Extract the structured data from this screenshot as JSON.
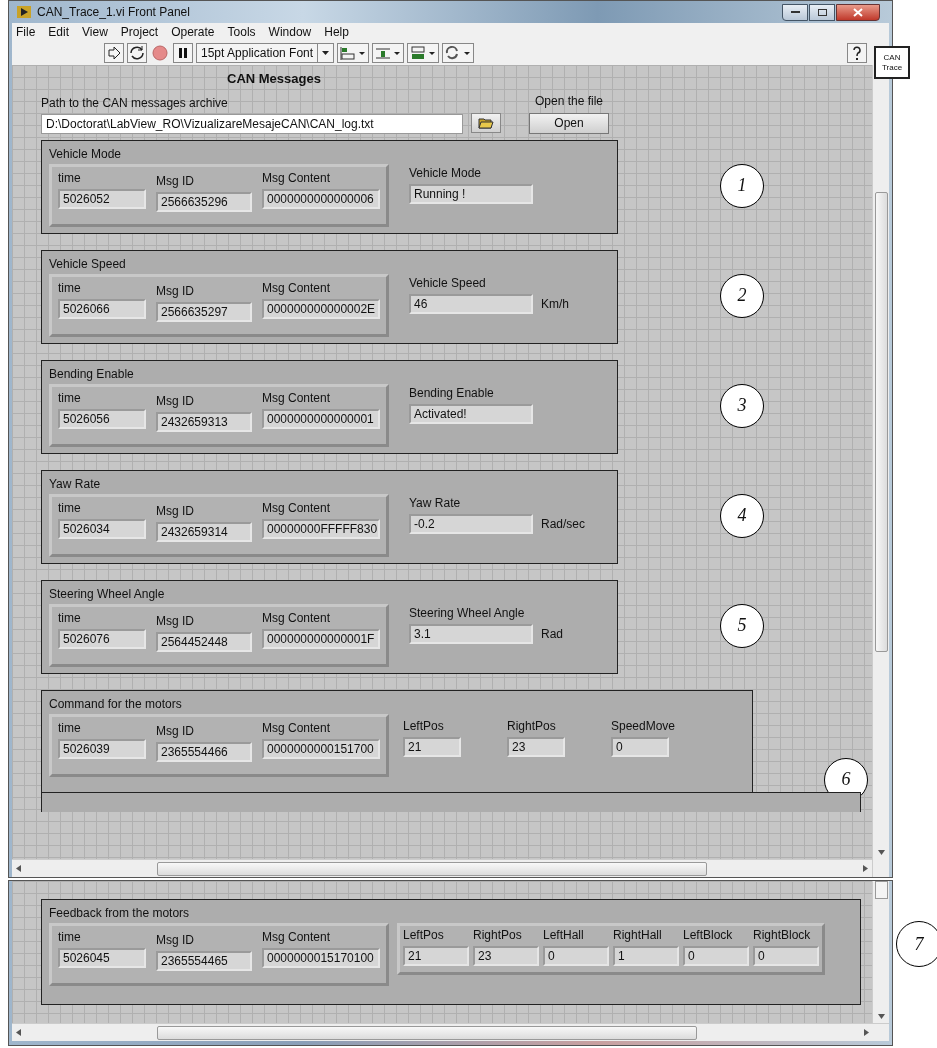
{
  "window": {
    "title": "CAN_Trace_1.vi Front Panel"
  },
  "menu": [
    "File",
    "Edit",
    "View",
    "Project",
    "Operate",
    "Tools",
    "Window",
    "Help"
  ],
  "toolbar": {
    "font": "15pt Application Font",
    "vi_icon": "CAN Trace"
  },
  "panel": {
    "heading": "CAN Messages",
    "path_label": "Path to the CAN messages archive",
    "path": "D:\\Doctorat\\LabView_RO\\VizualizareMesajeCAN\\CAN_log.txt",
    "open_label": "Open the file",
    "open_button": "Open"
  },
  "clusters": [
    {
      "kind": "wide",
      "title": "Vehicle Mode",
      "fields": [
        {
          "label": "time",
          "value": "5026052"
        },
        {
          "label": "Msg ID",
          "value": "2566635296"
        },
        {
          "label": "Msg Content",
          "value": "0000000000000006"
        }
      ],
      "outputs": [
        {
          "label": "Vehicle Mode",
          "value": "Running !"
        }
      ],
      "annotation": "1"
    },
    {
      "kind": "wide",
      "title": "Vehicle Speed",
      "fields": [
        {
          "label": "time",
          "value": "5026066"
        },
        {
          "label": "Msg ID",
          "value": "2566635297"
        },
        {
          "label": "Msg Content",
          "value": "000000000000002E"
        }
      ],
      "outputs": [
        {
          "label": "Vehicle Speed",
          "value": "46",
          "unit": "Km/h"
        }
      ],
      "annotation": "2"
    },
    {
      "kind": "wide",
      "title": "Bending Enable",
      "fields": [
        {
          "label": "time",
          "value": "5026056"
        },
        {
          "label": "Msg ID",
          "value": "2432659313"
        },
        {
          "label": "Msg Content",
          "value": "0000000000000001"
        }
      ],
      "outputs": [
        {
          "label": "Bending Enable",
          "value": "Activated!"
        }
      ],
      "annotation": "3"
    },
    {
      "kind": "wide",
      "title": "Yaw Rate",
      "fields": [
        {
          "label": "time",
          "value": "5026034"
        },
        {
          "label": "Msg ID",
          "value": "2432659314"
        },
        {
          "label": "Msg Content",
          "value": "00000000FFFFF830"
        }
      ],
      "outputs": [
        {
          "label": "Yaw Rate",
          "value": "-0.2",
          "unit": "Rad/sec"
        }
      ],
      "annotation": "4"
    },
    {
      "kind": "wide",
      "title": "Steering Wheel Angle",
      "fields": [
        {
          "label": "time",
          "value": "5026076"
        },
        {
          "label": "Msg ID",
          "value": "2564452448"
        },
        {
          "label": "Msg Content",
          "value": "000000000000001F"
        }
      ],
      "outputs": [
        {
          "label": "Steering Wheel Angle",
          "value": "3.1",
          "unit": "Rad"
        }
      ],
      "annotation": "5"
    },
    {
      "kind": "row",
      "title": "Command for the motors",
      "fields": [
        {
          "label": "time",
          "value": "5026039"
        },
        {
          "label": "Msg ID",
          "value": "2365554466"
        },
        {
          "label": "Msg Content",
          "value": "0000000000151700"
        }
      ],
      "outputs": [
        {
          "label": "LeftPos",
          "value": "21"
        },
        {
          "label": "RightPos",
          "value": "23"
        },
        {
          "label": "SpeedMove",
          "value": "0"
        }
      ],
      "annotation": "6"
    }
  ],
  "feedback": {
    "kind": "grouped",
    "title": "Feedback from the motors",
    "fields": [
      {
        "label": "time",
        "value": "5026045"
      },
      {
        "label": "Msg ID",
        "value": "2365554465"
      },
      {
        "label": "Msg Content",
        "value": "0000000015170100"
      }
    ],
    "outputs": [
      {
        "label": "LeftPos",
        "value": "21"
      },
      {
        "label": "RightPos",
        "value": "23"
      },
      {
        "label": "LeftHall",
        "value": "0"
      },
      {
        "label": "RightHall",
        "value": "1"
      },
      {
        "label": "LeftBlock",
        "value": "0"
      },
      {
        "label": "RightBlock",
        "value": "0"
      }
    ],
    "annotation": "7"
  }
}
